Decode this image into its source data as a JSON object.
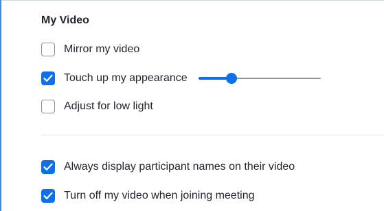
{
  "section": {
    "title": "My Video"
  },
  "options": {
    "mirror": {
      "label": "Mirror my video",
      "checked": false
    },
    "touch_up": {
      "label": "Touch up my appearance",
      "checked": true,
      "slider_value": 0.27
    },
    "low_light": {
      "label": "Adjust for low light",
      "checked": false
    },
    "display_names": {
      "label": "Always display participant names on their video",
      "checked": true
    },
    "turn_off_video": {
      "label": "Turn off my video when joining meeting",
      "checked": true
    }
  },
  "colors": {
    "accent": "#0e71eb",
    "text": "#232333",
    "checkbox_border": "#8a8f98",
    "frame_border": "#3a8dde"
  }
}
